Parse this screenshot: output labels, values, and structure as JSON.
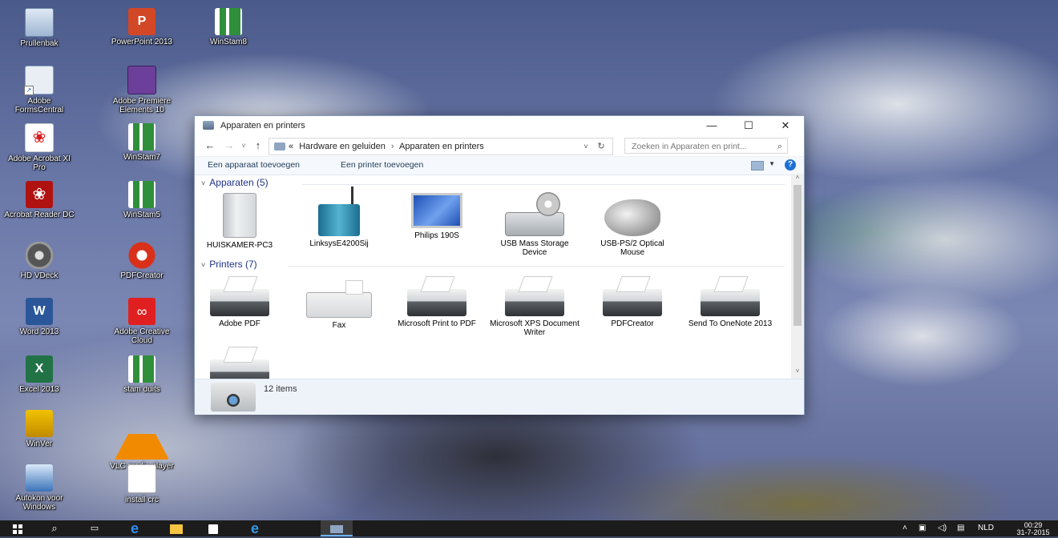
{
  "desktop": {
    "icons": [
      {
        "label": "Prullenbak",
        "icon": "recycle-bin-icon"
      },
      {
        "label": "PowerPoint 2013",
        "icon": "powerpoint-icon"
      },
      {
        "label": "WinStam8",
        "icon": "winstam-icon"
      },
      {
        "label": "Adobe FormsCentral",
        "icon": "adobe-formscentral-icon"
      },
      {
        "label": "Adobe Premiere Elements 10",
        "icon": "adobe-premiere-icon"
      },
      {
        "label": "Adobe Acrobat XI Pro",
        "icon": "adobe-acrobat-icon"
      },
      {
        "label": "WinStam7",
        "icon": "winstam-icon"
      },
      {
        "label": "Acrobat Reader DC",
        "icon": "acrobat-reader-icon"
      },
      {
        "label": "WinStam5",
        "icon": "winstam-icon"
      },
      {
        "label": "HD VDeck",
        "icon": "hd-vdeck-icon"
      },
      {
        "label": "PDFCreator",
        "icon": "pdfcreator-icon"
      },
      {
        "label": "Word 2013",
        "icon": "word-icon"
      },
      {
        "label": "Adobe Creative Cloud",
        "icon": "creative-cloud-icon"
      },
      {
        "label": "Excel 2013",
        "icon": "excel-icon"
      },
      {
        "label": "stam duits",
        "icon": "winstam-icon"
      },
      {
        "label": "WinVer",
        "icon": "winver-icon"
      },
      {
        "label": "VLC media player",
        "icon": "vlc-icon"
      },
      {
        "label": "Autokon voor Windows",
        "icon": "autokon-icon"
      },
      {
        "label": "install crc",
        "icon": "install-crc-icon"
      }
    ],
    "glyphs": {
      "ppt": "P",
      "word": "W",
      "excel": "X",
      "acrobat": "❀",
      "cc": "∞",
      "shortcut": "↗"
    }
  },
  "window": {
    "title": "Apparaten en printers",
    "controls": {
      "minimize": "—",
      "maximize": "☐",
      "close": "✕"
    },
    "nav": {
      "back": "←",
      "forward": "→",
      "recent": "˅",
      "up": "↑"
    },
    "address": {
      "overflow": "«",
      "crumbs": [
        "Hardware en geluiden",
        "Apparaten en printers"
      ],
      "separator": "›",
      "dropdown": "˅",
      "refresh": "↻"
    },
    "search": {
      "placeholder": "Zoeken in Apparaten en print...",
      "icon": "⌕"
    },
    "commands": {
      "add_device": "Een apparaat toevoegen",
      "add_printer": "Een printer toevoegen",
      "help": "?",
      "view_drop": "▼"
    },
    "groups": {
      "devices": {
        "title": "Apparaten (5)",
        "chevron": "˅",
        "items": [
          {
            "label": "HUISKAMER-PC3",
            "icon": "computer-icon"
          },
          {
            "label": "LinksysE4200Sij",
            "icon": "router-icon"
          },
          {
            "label": "Philips 190S",
            "icon": "monitor-icon"
          },
          {
            "label": "USB Mass Storage Device",
            "icon": "usb-storage-icon"
          },
          {
            "label": "USB-PS/2 Optical Mouse",
            "icon": "mouse-icon"
          }
        ]
      },
      "printers": {
        "title": "Printers (7)",
        "chevron": "˅",
        "items": [
          {
            "label": "Adobe PDF",
            "icon": "printer-icon"
          },
          {
            "label": "Fax",
            "icon": "fax-icon"
          },
          {
            "label": "Microsoft Print to PDF",
            "icon": "printer-icon"
          },
          {
            "label": "Microsoft XPS Document Writer",
            "icon": "printer-icon"
          },
          {
            "label": "PDFCreator",
            "icon": "printer-icon"
          },
          {
            "label": "Send To OneNote 2013",
            "icon": "printer-icon"
          },
          {
            "label": "",
            "icon": "printer-icon"
          }
        ]
      }
    },
    "scroll": {
      "up": "˄",
      "down": "˅"
    },
    "status": {
      "count": "12 items"
    }
  },
  "taskbar": {
    "start": "",
    "search": "⌕",
    "taskview": "▭",
    "edge": "e",
    "ie": "e",
    "tray": {
      "chevron": "˄",
      "network": "▣",
      "volume": "◁)",
      "action": "▤",
      "language": "NLD",
      "time": "00:29",
      "date": "31-7-2015"
    }
  }
}
